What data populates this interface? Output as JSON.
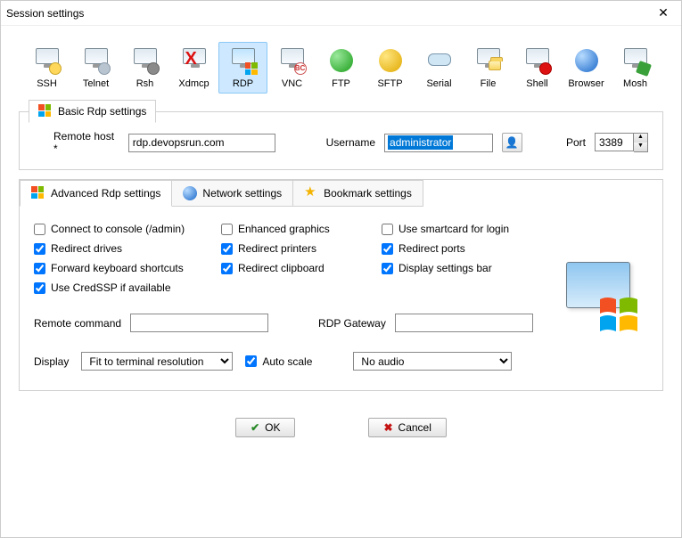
{
  "window": {
    "title": "Session settings"
  },
  "session_types": [
    {
      "key": "ssh",
      "label": "SSH"
    },
    {
      "key": "telnet",
      "label": "Telnet"
    },
    {
      "key": "rsh",
      "label": "Rsh"
    },
    {
      "key": "xdmcp",
      "label": "Xdmcp"
    },
    {
      "key": "rdp",
      "label": "RDP",
      "selected": true
    },
    {
      "key": "vnc",
      "label": "VNC"
    },
    {
      "key": "ftp",
      "label": "FTP"
    },
    {
      "key": "sftp",
      "label": "SFTP"
    },
    {
      "key": "serial",
      "label": "Serial"
    },
    {
      "key": "file",
      "label": "File"
    },
    {
      "key": "shell",
      "label": "Shell"
    },
    {
      "key": "browser",
      "label": "Browser"
    },
    {
      "key": "mosh",
      "label": "Mosh"
    }
  ],
  "basic": {
    "group_label": "Basic Rdp settings",
    "remote_host_label": "Remote host *",
    "remote_host_value": "rdp.devopsrun.com",
    "username_label": "Username",
    "username_value": "administrator",
    "port_label": "Port",
    "port_value": "3389"
  },
  "tabs": {
    "advanced": "Advanced Rdp settings",
    "network": "Network settings",
    "bookmark": "Bookmark settings"
  },
  "advanced": {
    "checks": {
      "connect_console": {
        "label": "Connect to console (/admin)",
        "checked": false
      },
      "enhanced_graphics": {
        "label": "Enhanced graphics",
        "checked": false
      },
      "smartcard": {
        "label": "Use smartcard for login",
        "checked": false
      },
      "redirect_drives": {
        "label": "Redirect drives",
        "checked": true
      },
      "redirect_printers": {
        "label": "Redirect printers",
        "checked": true
      },
      "redirect_ports": {
        "label": "Redirect ports",
        "checked": true
      },
      "fwd_kbd": {
        "label": "Forward keyboard shortcuts",
        "checked": true
      },
      "redirect_clipboard": {
        "label": "Redirect clipboard",
        "checked": true
      },
      "display_settings_bar": {
        "label": "Display settings bar",
        "checked": true
      },
      "credssp": {
        "label": "Use CredSSP if available",
        "checked": true
      }
    },
    "remote_command_label": "Remote command",
    "remote_command_value": "",
    "rdp_gateway_label": "RDP Gateway",
    "rdp_gateway_value": "",
    "display_label": "Display",
    "display_value": "Fit to terminal resolution",
    "auto_scale_label": "Auto scale",
    "auto_scale_checked": true,
    "audio_value": "No audio"
  },
  "buttons": {
    "ok": "OK",
    "cancel": "Cancel"
  }
}
